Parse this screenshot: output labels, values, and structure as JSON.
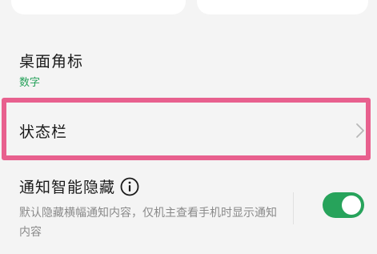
{
  "settings": {
    "badge": {
      "title": "桌面角标",
      "value": "数字"
    },
    "status_bar": {
      "title": "状态栏"
    },
    "notification_hide": {
      "title": "通知智能隐藏",
      "description": "默认隐藏横幅通知内容，仅机主查看手机时显示通知内容",
      "enabled": true
    }
  },
  "colors": {
    "accent_green": "#27a35b",
    "highlight_pink": "#e8608e"
  },
  "icons": {
    "chevron": "chevron-right-icon",
    "info": "info-icon"
  }
}
